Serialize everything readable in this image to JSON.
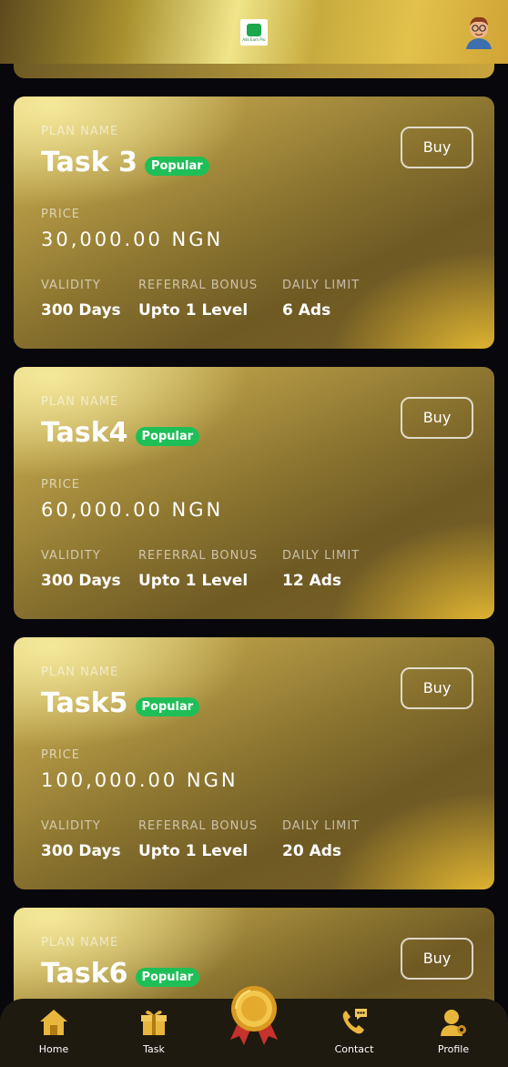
{
  "header": {
    "logo_text": "Ads Earn Pro",
    "avatar_icon": "user-avatar"
  },
  "plans": [
    {
      "plan_label": "PLAN NAME",
      "name": "Task 3",
      "badge": "Popular",
      "buy_label": "Buy",
      "price_label": "PRICE",
      "price": "30,000.00 NGN",
      "validity_label": "VALIDITY",
      "validity": "300 Days",
      "referral_label": "REFERRAL BONUS",
      "referral": "Upto 1 Level",
      "limit_label": "DAILY LIMIT",
      "limit": "6 Ads"
    },
    {
      "plan_label": "PLAN NAME",
      "name": "Task4",
      "badge": "Popular",
      "buy_label": "Buy",
      "price_label": "PRICE",
      "price": "60,000.00 NGN",
      "validity_label": "VALIDITY",
      "validity": "300 Days",
      "referral_label": "REFERRAL BONUS",
      "referral": "Upto 1 Level",
      "limit_label": "DAILY LIMIT",
      "limit": "12 Ads"
    },
    {
      "plan_label": "PLAN NAME",
      "name": "Task5",
      "badge": "Popular",
      "buy_label": "Buy",
      "price_label": "PRICE",
      "price": "100,000.00 NGN",
      "validity_label": "VALIDITY",
      "validity": "300 Days",
      "referral_label": "REFERRAL BONUS",
      "referral": "Upto 1 Level",
      "limit_label": "DAILY LIMIT",
      "limit": "20 Ads"
    },
    {
      "plan_label": "PLAN NAME",
      "name": "Task6",
      "badge": "Popular",
      "buy_label": "Buy"
    }
  ],
  "nav": {
    "items": [
      {
        "label": "Home",
        "icon": "home-icon"
      },
      {
        "label": "Task",
        "icon": "gift-icon"
      },
      {
        "label": "",
        "icon": "medal-icon"
      },
      {
        "label": "Contact",
        "icon": "phone-chat-icon"
      },
      {
        "label": "Profile",
        "icon": "profile-icon"
      }
    ]
  },
  "colors": {
    "background": "#07070c",
    "gold_accent": "#d4a83a",
    "badge_green": "#1fbf57",
    "nav_background": "#1f1a10"
  }
}
